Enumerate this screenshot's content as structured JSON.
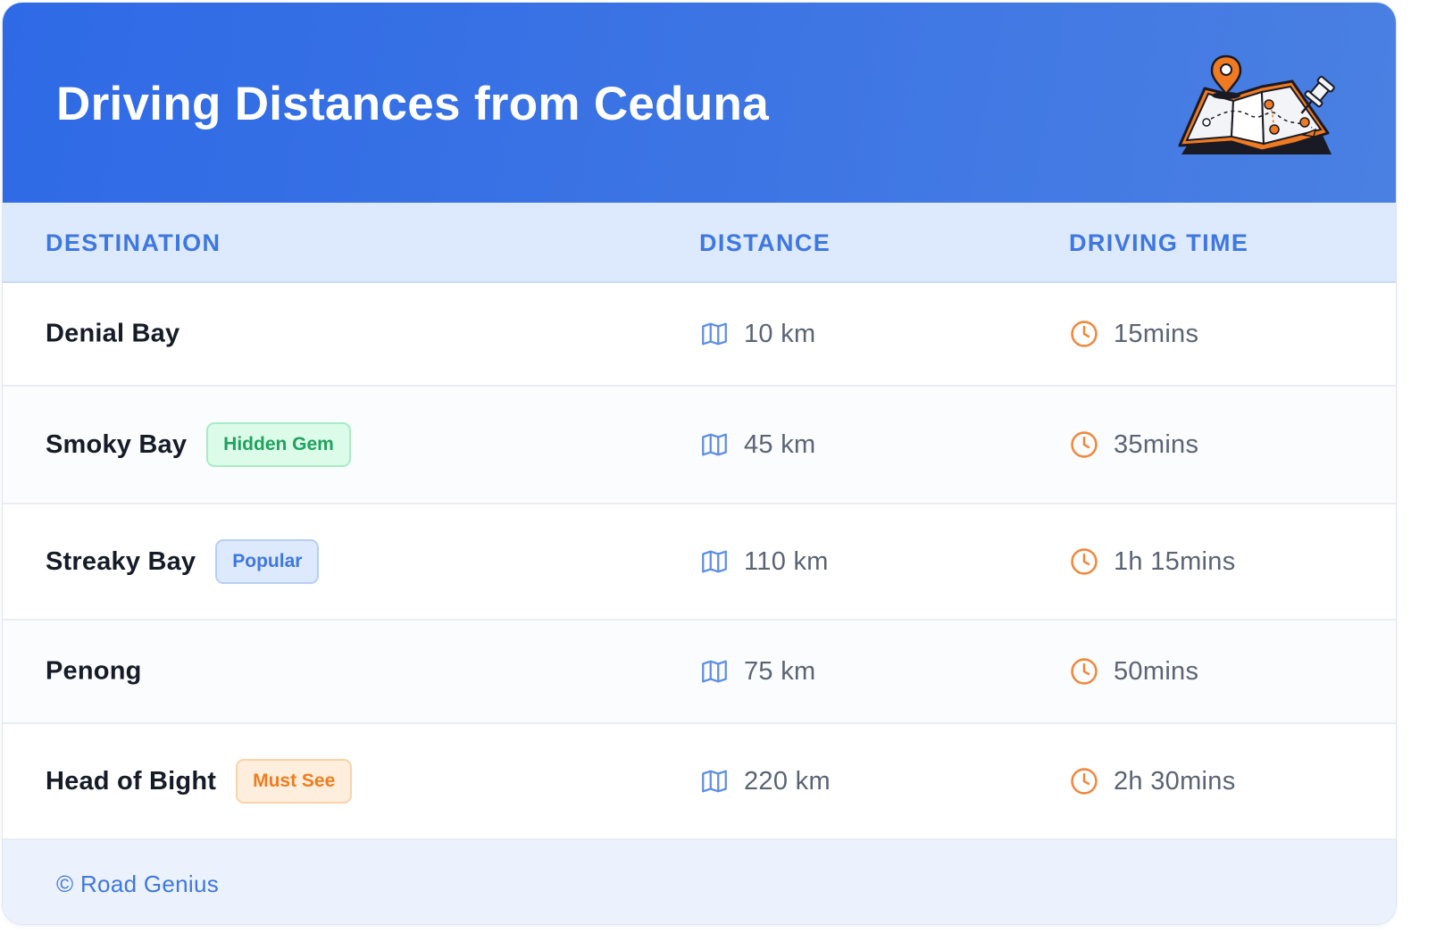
{
  "header": {
    "title": "Driving Distances from Ceduna",
    "illustration_icon": "map-with-pins-icon"
  },
  "columns": {
    "destination": "DESTINATION",
    "distance": "DISTANCE",
    "driving_time": "DRIVING TIME"
  },
  "rows": [
    {
      "destination": "Denial Bay",
      "badge": "",
      "badge_color": "",
      "distance": "10 km",
      "time": "15mins"
    },
    {
      "destination": "Smoky Bay",
      "badge": "Hidden Gem",
      "badge_color": "green",
      "distance": "45 km",
      "time": "35mins"
    },
    {
      "destination": "Streaky Bay",
      "badge": "Popular",
      "badge_color": "blue",
      "distance": "110 km",
      "time": "1h 15mins"
    },
    {
      "destination": "Penong",
      "badge": "",
      "badge_color": "",
      "distance": "75 km",
      "time": "50mins"
    },
    {
      "destination": "Head of Bight",
      "badge": "Must See",
      "badge_color": "orange",
      "distance": "220 km",
      "time": "2h 30mins"
    }
  ],
  "icons": {
    "distance": "map-icon",
    "time": "clock-icon"
  },
  "footer": {
    "text": "© Road Genius"
  },
  "colors": {
    "header_gradient_start": "#2f6ae6",
    "header_gradient_end": "#4a80e2",
    "accent_blue": "#3e77e0",
    "clock_orange": "#f0883e",
    "badge_green": "#1fa260",
    "badge_orange": "#ef7d1e"
  }
}
